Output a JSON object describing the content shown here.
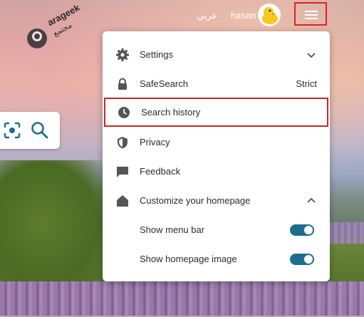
{
  "brand": {
    "logo_text": "arageek",
    "logo_sub": "مجتمع"
  },
  "topbar": {
    "language_label": "عربي",
    "username": "hasan",
    "avatar_icon": "duck-avatar-icon",
    "menu_icon": "hamburger-menu-icon"
  },
  "search_widget": {
    "camera_icon": "visual-search-icon",
    "search_icon": "search-icon"
  },
  "menu": {
    "settings": {
      "label": "Settings",
      "icon": "gear-icon"
    },
    "safesearch": {
      "label": "SafeSearch",
      "value": "Strict",
      "icon": "lock-icon"
    },
    "search_history": {
      "label": "Search history",
      "icon": "clock-icon"
    },
    "privacy": {
      "label": "Privacy",
      "icon": "shield-icon"
    },
    "feedback": {
      "label": "Feedback",
      "icon": "chat-icon"
    },
    "customize": {
      "label": "Customize your homepage",
      "icon": "home-icon"
    },
    "show_menu_bar": {
      "label": "Show menu bar",
      "enabled": true
    },
    "show_homepage_image": {
      "label": "Show homepage image",
      "enabled": true
    }
  },
  "colors": {
    "toggle_on": "#1b6e8e",
    "highlight": "#c62828"
  }
}
